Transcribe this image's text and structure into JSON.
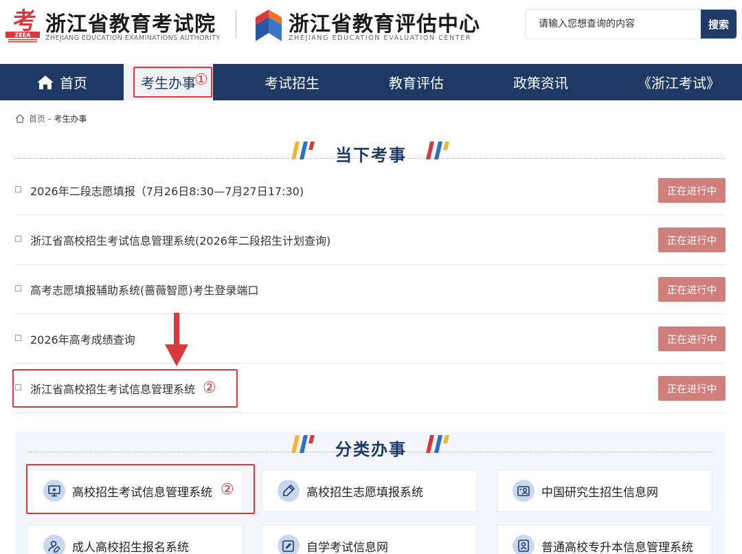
{
  "header": {
    "org1": {
      "name": "浙江省教育考试院",
      "name_en": "ZHEJIANG EDUCATION EXAMINATIONS AUTHORITY",
      "logo_char": "考",
      "logo_abbr": "ZEEA"
    },
    "org2": {
      "name": "浙江省教育评估中心",
      "name_en": "ZHEJIANG EDUCATION EVALUATION CENTER"
    },
    "search": {
      "placeholder": "请输入您想查询的内容",
      "button": "搜索"
    }
  },
  "nav": {
    "items": [
      {
        "label": "首页"
      },
      {
        "label": "考生办事"
      },
      {
        "label": "考试招生"
      },
      {
        "label": "教育评估"
      },
      {
        "label": "政策资讯"
      },
      {
        "label": "《浙江考试》"
      }
    ],
    "active_index": 1
  },
  "breadcrumb": {
    "home": "首页",
    "sep": "-",
    "current": "考生办事"
  },
  "annotations": {
    "step1": "①",
    "step2": "②"
  },
  "current_affairs": {
    "title": "当下考事",
    "items": [
      {
        "text": "2026年二段志愿填报（7月26日8:30—7月27日17:30)",
        "status": "正在进行中"
      },
      {
        "text": "浙江省高校招生考试信息管理系统(2026年二段招生计划查询)",
        "status": "正在进行中"
      },
      {
        "text": "高考志愿填报辅助系统(蔷薇智愿)考生登录端口",
        "status": "正在进行中"
      },
      {
        "text": "2026年高考成绩查询",
        "status": "正在进行中"
      },
      {
        "text": "浙江省高校招生考试信息管理系统",
        "status": "正在进行中"
      }
    ]
  },
  "categories": {
    "title": "分类办事",
    "items": [
      {
        "label": "高校招生考试信息管理系统",
        "icon": "monitor-icon"
      },
      {
        "label": "高校招生志愿填报系统",
        "icon": "pencil-icon"
      },
      {
        "label": "中国研究生招生信息网",
        "icon": "id-card-icon"
      },
      {
        "label": "成人高校招生报名系统",
        "icon": "user-edit-icon"
      },
      {
        "label": "自学考试信息网",
        "icon": "edit-icon"
      },
      {
        "label": "普通高校专升本信息管理系统",
        "icon": "person-card-icon"
      }
    ]
  },
  "colors": {
    "navy": "#1e3a64",
    "status": "#d07f7c",
    "highlight": "#d9393a"
  }
}
